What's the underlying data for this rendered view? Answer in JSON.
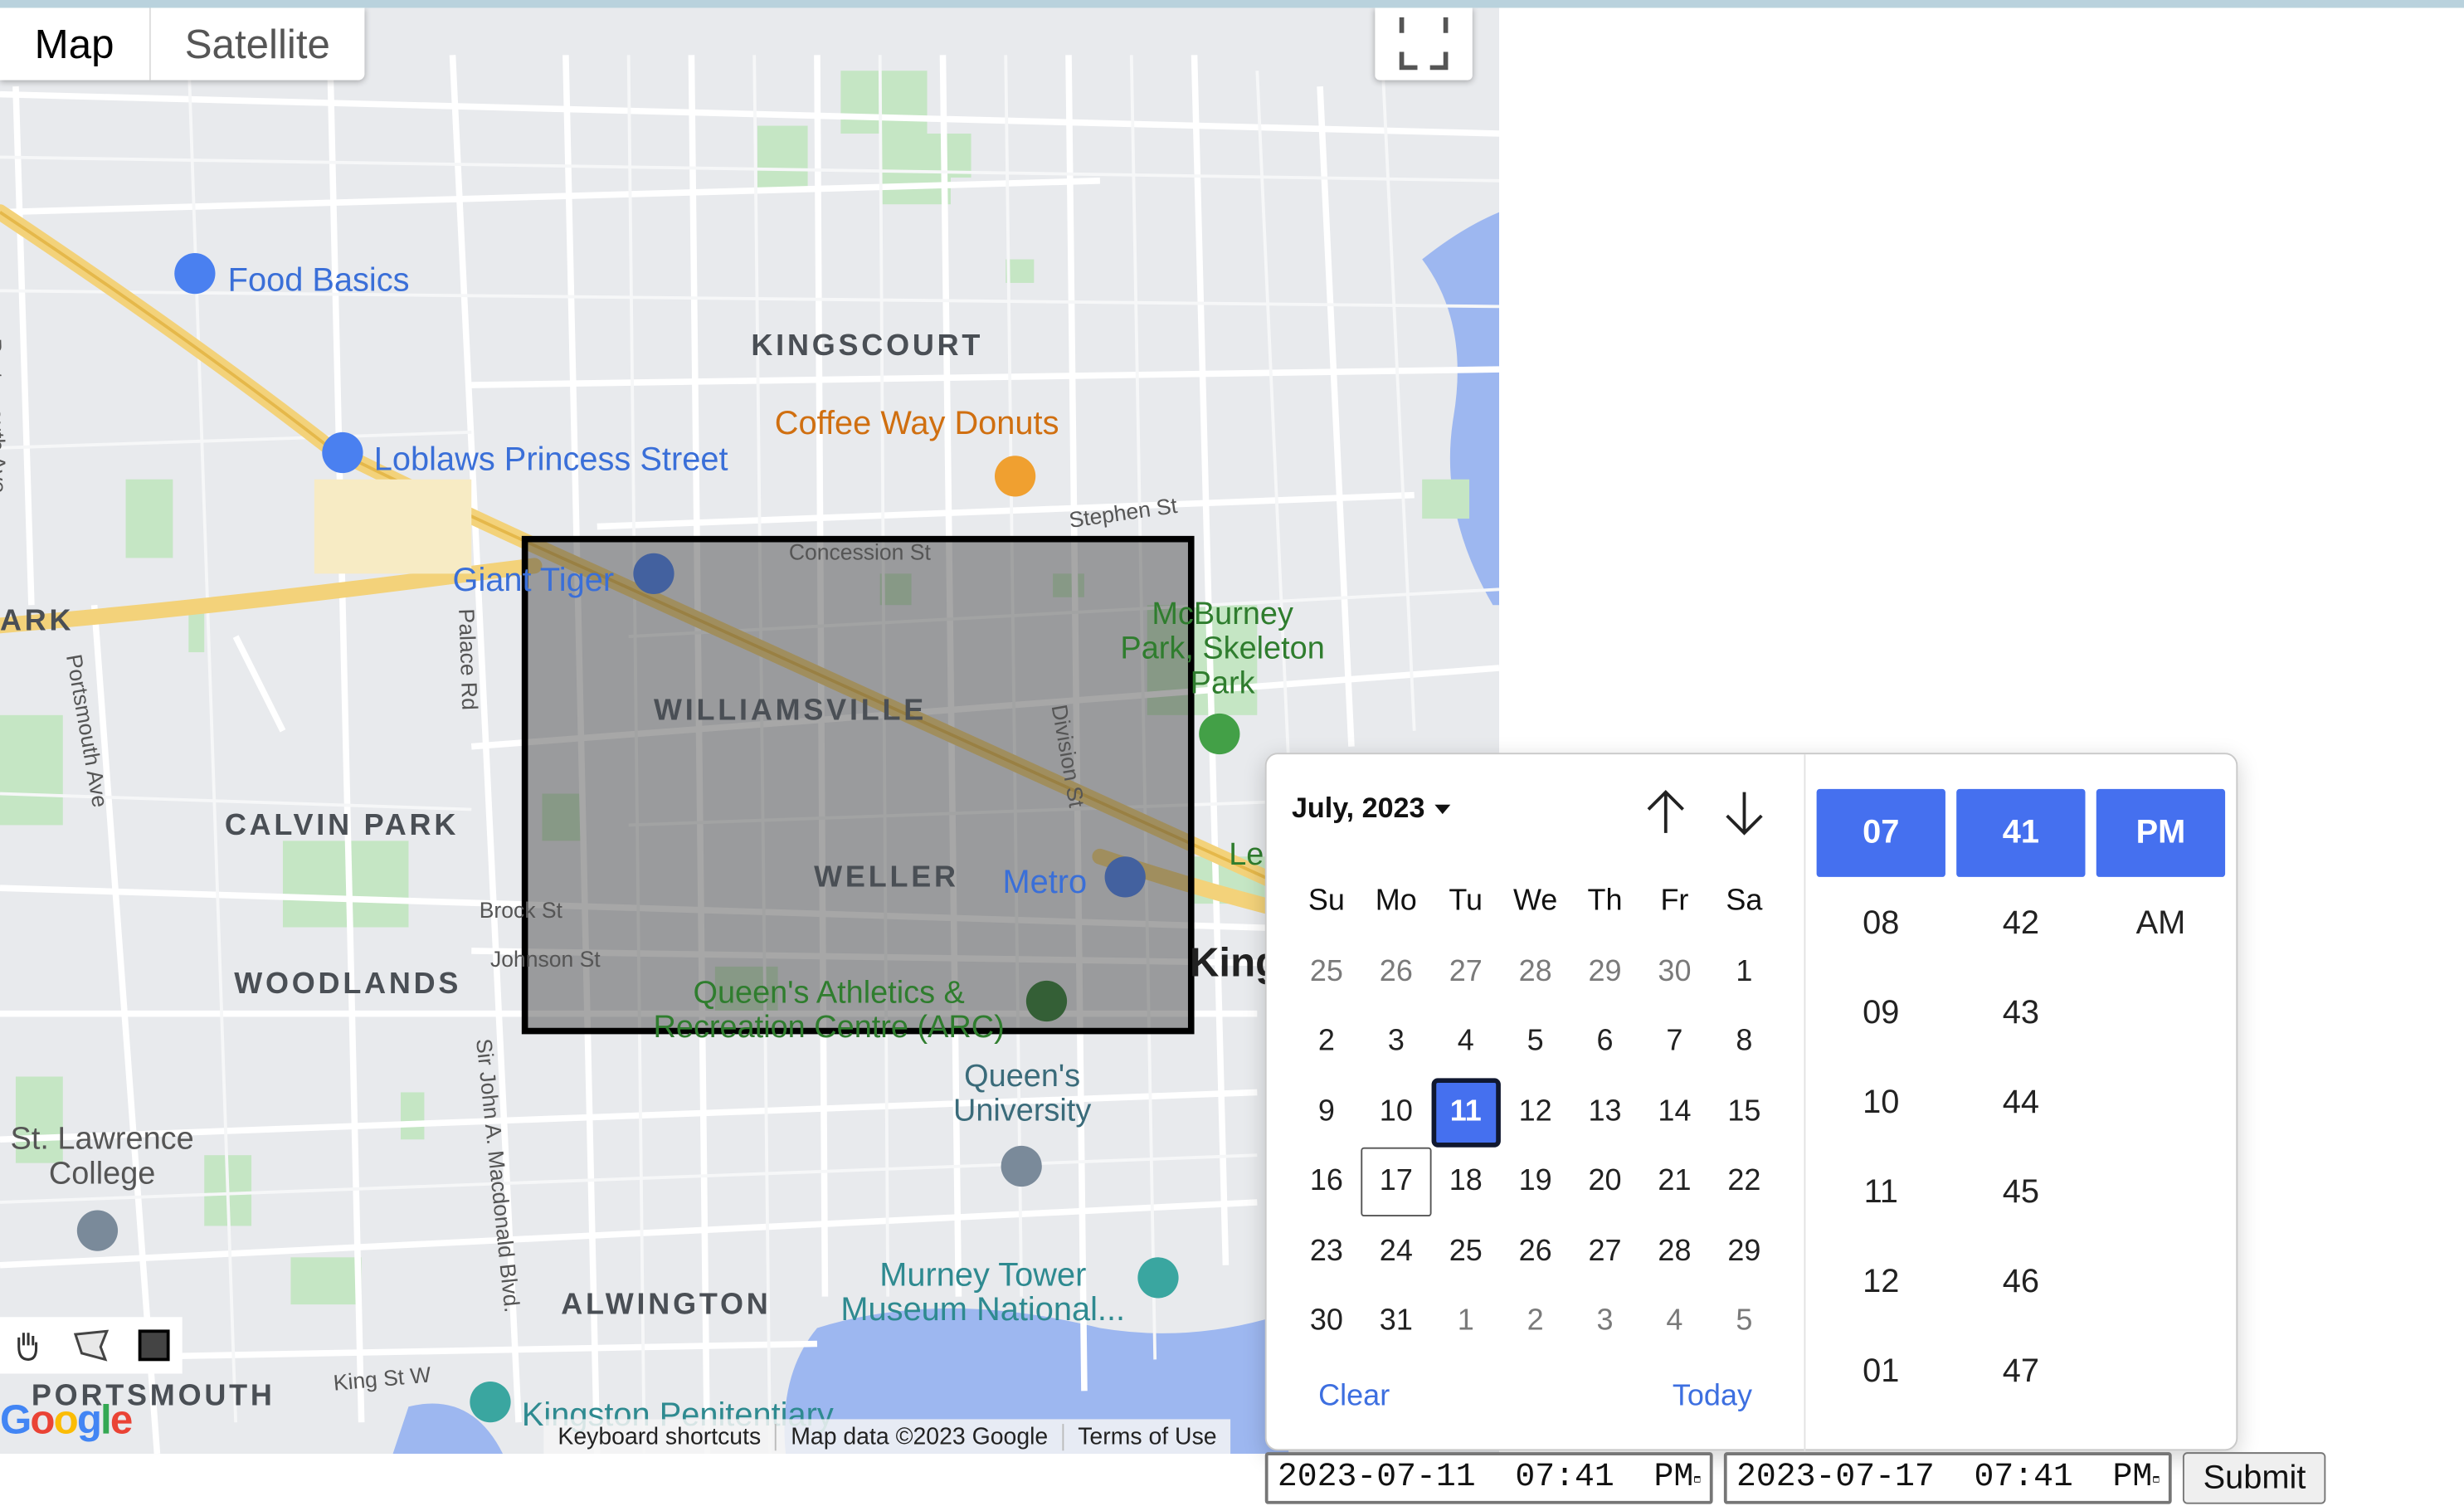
{
  "map": {
    "type_controls": {
      "map": "Map",
      "satellite": "Satellite"
    },
    "neighborhoods": [
      "KINGSCOURT",
      "WILLIAMSVILLE",
      "CALVIN PARK",
      "WELLER",
      "WOODLANDS",
      "ALWINGTON",
      "PORTSMOUTH"
    ],
    "pois": {
      "food_basics": "Food Basics",
      "loblaws": "Loblaws Princess Street",
      "coffee_way": "Coffee Way Donuts",
      "giant_tiger": "Giant Tiger",
      "mcburney": "McBurney Park, Skeleton Park",
      "metro": "Metro",
      "queens_arc": "Queen's Athletics & Recreation Centre (ARC)",
      "queens_univ": "Queen's University",
      "st_lawrence": "St. Lawrence College",
      "murney": "Murney Tower Museum National...",
      "penitentiary": "Kingston Penitentiary"
    },
    "streets": {
      "portsmouth1": "Portsmouth Ave",
      "portsmouth2": "Portsmouth Ave",
      "stephen": "Stephen St",
      "concession": "Concession St",
      "palace": "Palace Rd",
      "division": "Division St",
      "brock": "Brock St",
      "johnson": "Johnson St",
      "macdonald": "Sir John A. Macdonald Blvd.",
      "king": "King St W",
      "ark": "ARK"
    },
    "city_label": "King",
    "left_label": "Le",
    "attribution": [
      "Keyboard shortcuts",
      "Map data ©2023 Google",
      "Terms of Use"
    ],
    "logo": "Google"
  },
  "picker": {
    "month_label": "July, 2023",
    "weekdays": [
      "Su",
      "Mo",
      "Tu",
      "We",
      "Th",
      "Fr",
      "Sa"
    ],
    "weeks": [
      [
        "25",
        "26",
        "27",
        "28",
        "29",
        "30",
        "1"
      ],
      [
        "2",
        "3",
        "4",
        "5",
        "6",
        "7",
        "8"
      ],
      [
        "9",
        "10",
        "11",
        "12",
        "13",
        "14",
        "15"
      ],
      [
        "16",
        "17",
        "18",
        "19",
        "20",
        "21",
        "22"
      ],
      [
        "23",
        "24",
        "25",
        "26",
        "27",
        "28",
        "29"
      ],
      [
        "30",
        "31",
        "1",
        "2",
        "3",
        "4",
        "5"
      ]
    ],
    "selected_day": "11",
    "today_day": "17",
    "clear_label": "Clear",
    "today_label": "Today",
    "hours": [
      "07",
      "08",
      "09",
      "10",
      "11",
      "12",
      "01"
    ],
    "minutes": [
      "41",
      "42",
      "43",
      "44",
      "45",
      "46",
      "47"
    ],
    "meridiem": [
      "PM",
      "AM"
    ]
  },
  "form": {
    "start_value": "2023-07-11  07:41  PM",
    "end_value": "2023-07-17  07:41  PM",
    "submit_label": "Submit"
  },
  "colors": {
    "accent": "#4570ef",
    "selection_border": "#000000"
  }
}
